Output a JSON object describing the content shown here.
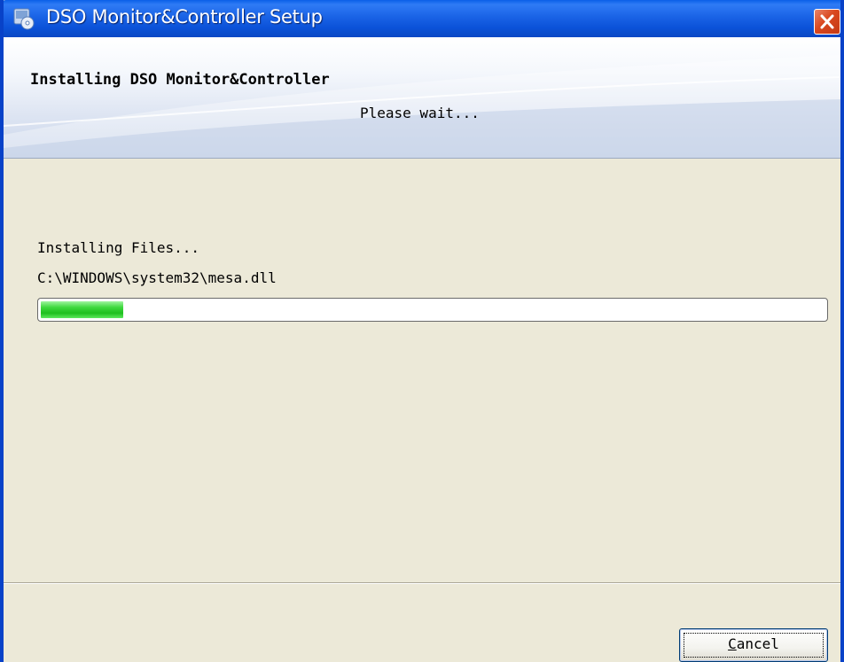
{
  "window": {
    "title": "DSO Monitor&Controller Setup"
  },
  "header": {
    "title": "Installing DSO Monitor&Controller",
    "subtitle": "Please wait..."
  },
  "main": {
    "status_label": "Installing Files...",
    "current_file": "C:\\WINDOWS\\system32\\mesa.dll",
    "progress": {
      "fraction": 0.105
    }
  },
  "footer": {
    "cancel_label_accel": "C",
    "cancel_label_rest": "ancel"
  },
  "colors": {
    "titlebar": "#0a5fe8",
    "window_bg": "#ece9d8",
    "progress_green": "#1fbf1f",
    "close_red": "#d9481f"
  },
  "icons": {
    "app": "setup-disc-icon",
    "close": "close-icon"
  }
}
